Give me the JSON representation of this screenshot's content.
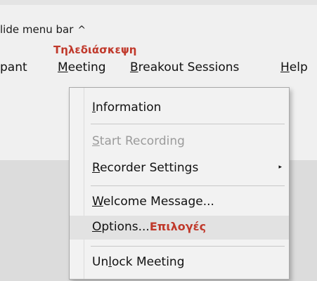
{
  "hide_menu_bar": {
    "label": "lide menu bar",
    "caret": "^"
  },
  "annotations": {
    "meeting_greek": "Τηλεδιάσκεψη",
    "options_greek": "Επιλογές"
  },
  "menubar": {
    "participant_partial": "pant",
    "meeting": {
      "ul": "M",
      "rest": "eeting"
    },
    "breakout": {
      "ul": "B",
      "rest": "reakout Sessions"
    },
    "help": {
      "ul": "H",
      "rest": "elp"
    }
  },
  "meeting_menu": {
    "information": {
      "ul": "I",
      "rest": "nformation"
    },
    "start_recording": {
      "ul": "S",
      "rest": "tart Recording"
    },
    "recorder_settings": {
      "ul": "R",
      "rest": "ecorder Settings",
      "arrow": "▸"
    },
    "welcome_message": {
      "ul": "W",
      "rest": "elcome Message..."
    },
    "options": {
      "ul": "O",
      "rest": "ptions..."
    },
    "unlock_meeting": {
      "pre": "Un",
      "ul": "l",
      "rest": "ock Meeting"
    }
  },
  "colors": {
    "annotation_red": "#c0392b",
    "menu_bg": "#f2f2f2",
    "highlight_bg": "#e2e2e2",
    "disabled_text": "#9b9b9b"
  }
}
